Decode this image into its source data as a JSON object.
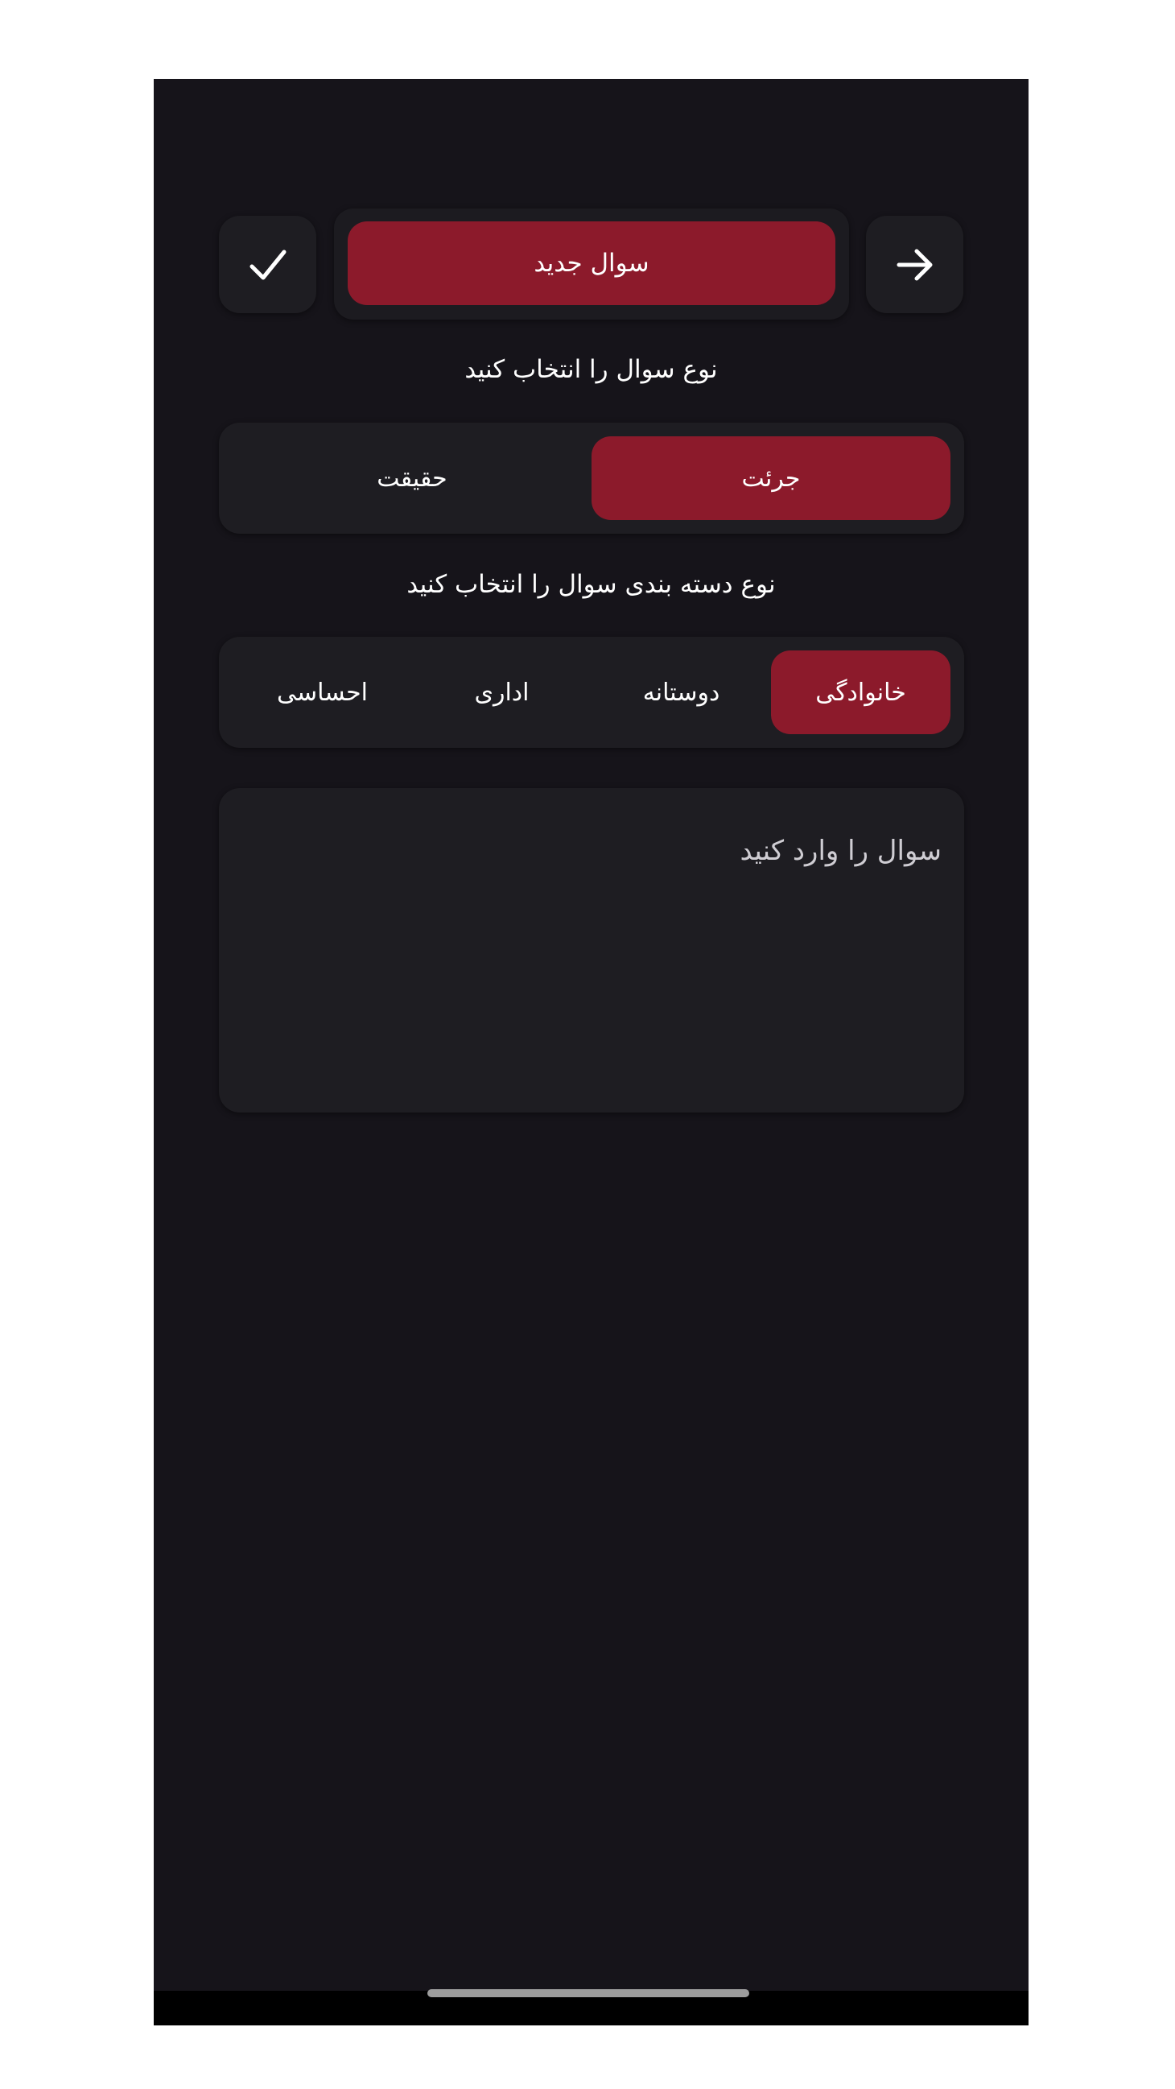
{
  "header": {
    "title": "سوال جدید",
    "check_icon": "check-icon",
    "back_icon": "arrow-right-icon"
  },
  "question_type": {
    "label": "نوع سوال را انتخاب کنید",
    "options": [
      {
        "label": "جرئت",
        "selected": true
      },
      {
        "label": "حقیقت",
        "selected": false
      }
    ]
  },
  "category": {
    "label": "نوع دسته بندی سوال را انتخاب کنید",
    "options": [
      {
        "label": "خانوادگی",
        "selected": true
      },
      {
        "label": "دوستانه",
        "selected": false
      },
      {
        "label": "اداری",
        "selected": false
      },
      {
        "label": "احساسی",
        "selected": false
      }
    ]
  },
  "question_input": {
    "placeholder": "سوال را وارد کنید",
    "value": ""
  },
  "colors": {
    "background": "#16141a",
    "surface": "#1e1d22",
    "accent": "#8c1a2b",
    "text": "#ffffff"
  }
}
